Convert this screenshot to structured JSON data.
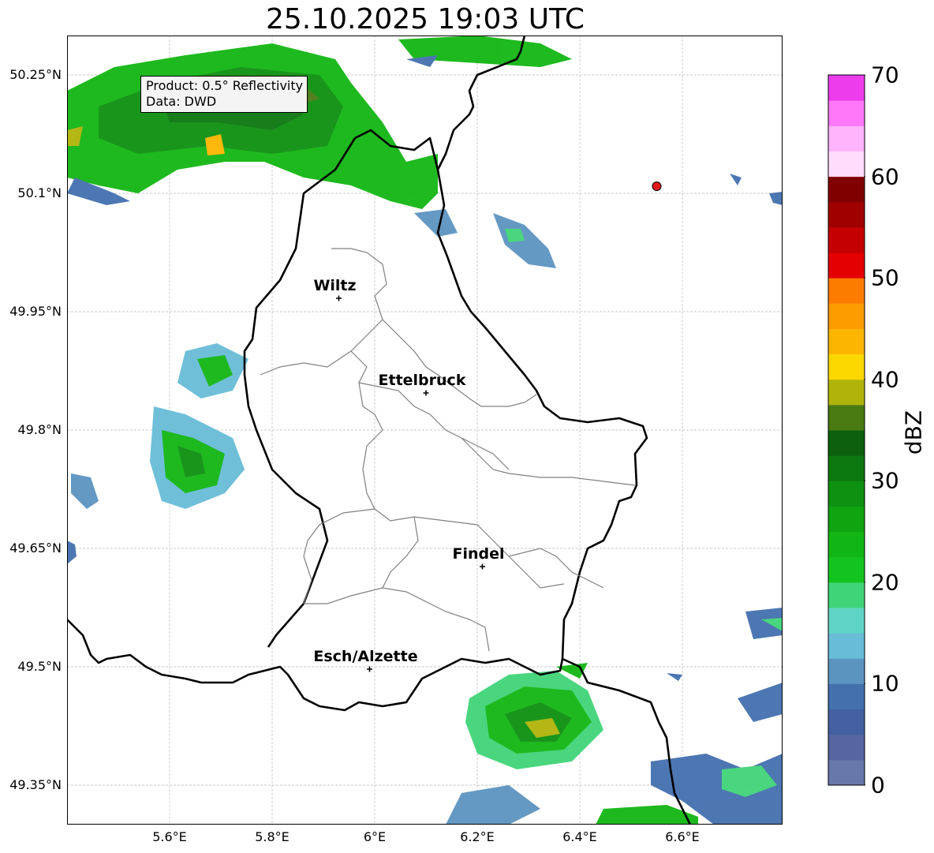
{
  "title": "25.10.2025 19:03 UTC",
  "info": {
    "product": "Product: 0.5° Reflectivity",
    "data": "Data: DWD"
  },
  "map": {
    "lat_ticks": [
      "50.25°N",
      "50.1°N",
      "49.95°N",
      "49.8°N",
      "49.65°N",
      "49.5°N",
      "49.35°N"
    ],
    "lon_ticks": [
      "5.6°E",
      "5.8°E",
      "6°E",
      "6.2°E",
      "6.4°E",
      "6.6°E"
    ],
    "cities": [
      {
        "name": "Wiltz",
        "lon": 5.93,
        "lat": 49.967
      },
      {
        "name": "Ettelbruck",
        "lon": 6.1,
        "lat": 49.847
      },
      {
        "name": "Findel",
        "lon": 6.21,
        "lat": 49.627
      },
      {
        "name": "Esch/Alzette",
        "lon": 5.99,
        "lat": 49.497
      }
    ],
    "radar_site": {
      "lon": 6.55,
      "lat": 50.109,
      "color": "#e31a1c"
    }
  },
  "colorbar": {
    "label": "dBZ",
    "ticks": [
      "0",
      "10",
      "20",
      "30",
      "40",
      "50",
      "60",
      "70"
    ],
    "colors": [
      "#6878a8",
      "#5566a0",
      "#4460a0",
      "#4470ae",
      "#5c94c0",
      "#68bcd8",
      "#60d4c4",
      "#40d478",
      "#14c41e",
      "#12b614",
      "#10a410",
      "#0e9010",
      "#0c7810",
      "#0c600e",
      "#4a7a12",
      "#b0b40a",
      "#fcd800",
      "#fcb600",
      "#fc9c00",
      "#fc7c00",
      "#e40000",
      "#c40000",
      "#a00000",
      "#800000",
      "#ffdcfc",
      "#ffb4fc",
      "#ff78f8",
      "#ec3cec"
    ]
  }
}
